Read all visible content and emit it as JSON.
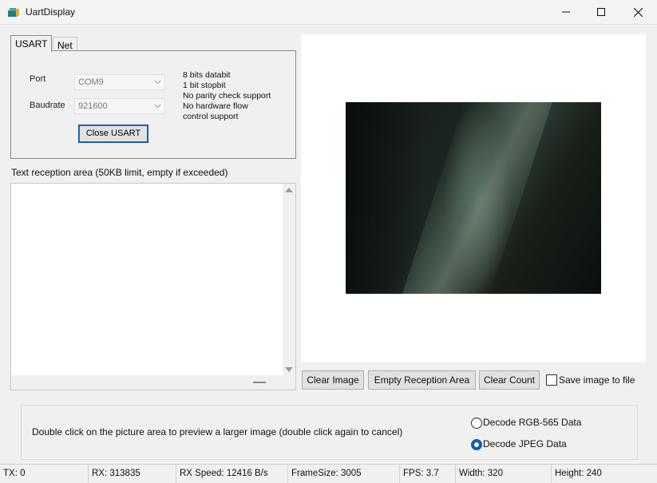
{
  "window": {
    "title": "UartDisplay",
    "minimize_glyph": "—",
    "maximize_glyph": "☐",
    "close_glyph": "✕"
  },
  "tabs": [
    {
      "label": "USART",
      "active": true
    },
    {
      "label": "Net",
      "active": false
    }
  ],
  "usart": {
    "port_label": "Port",
    "port_value": "COM9",
    "baudrate_label": "Baudrate",
    "baudrate_value": "921600",
    "close_button": "Close USART",
    "info_lines": [
      "8 bits databit",
      "1 bit stopbit",
      "No parity check support",
      "No hardware flow",
      "control support"
    ]
  },
  "reception": {
    "label": "Text reception area (50KB limit, empty if exceeded)",
    "text": ""
  },
  "picture": {
    "image_description_icon": "camera-frame"
  },
  "actions": {
    "clear_image": "Clear Image",
    "empty_reception": "Empty Reception Area",
    "clear_count": "Clear Count",
    "save_to_file_label": "Save image to file",
    "save_to_file_checked": false
  },
  "decode": {
    "hint": "Double click on the picture area to preview a larger image (double click again to cancel)",
    "options": [
      {
        "label": "Decode RGB-565 Data",
        "checked": false
      },
      {
        "label": "Decode JPEG Data",
        "checked": true
      }
    ]
  },
  "status": {
    "tx": "TX: 0",
    "rx": "RX: 313835",
    "rx_speed": "RX Speed: 12416 B/s",
    "frame_size": "FrameSize: 3005",
    "fps": "FPS: 3.7",
    "width": "Width: 320",
    "height": "Height: 240"
  },
  "colors": {
    "accent": "#0b5cbd",
    "window_bg": "#f0f0f0"
  }
}
